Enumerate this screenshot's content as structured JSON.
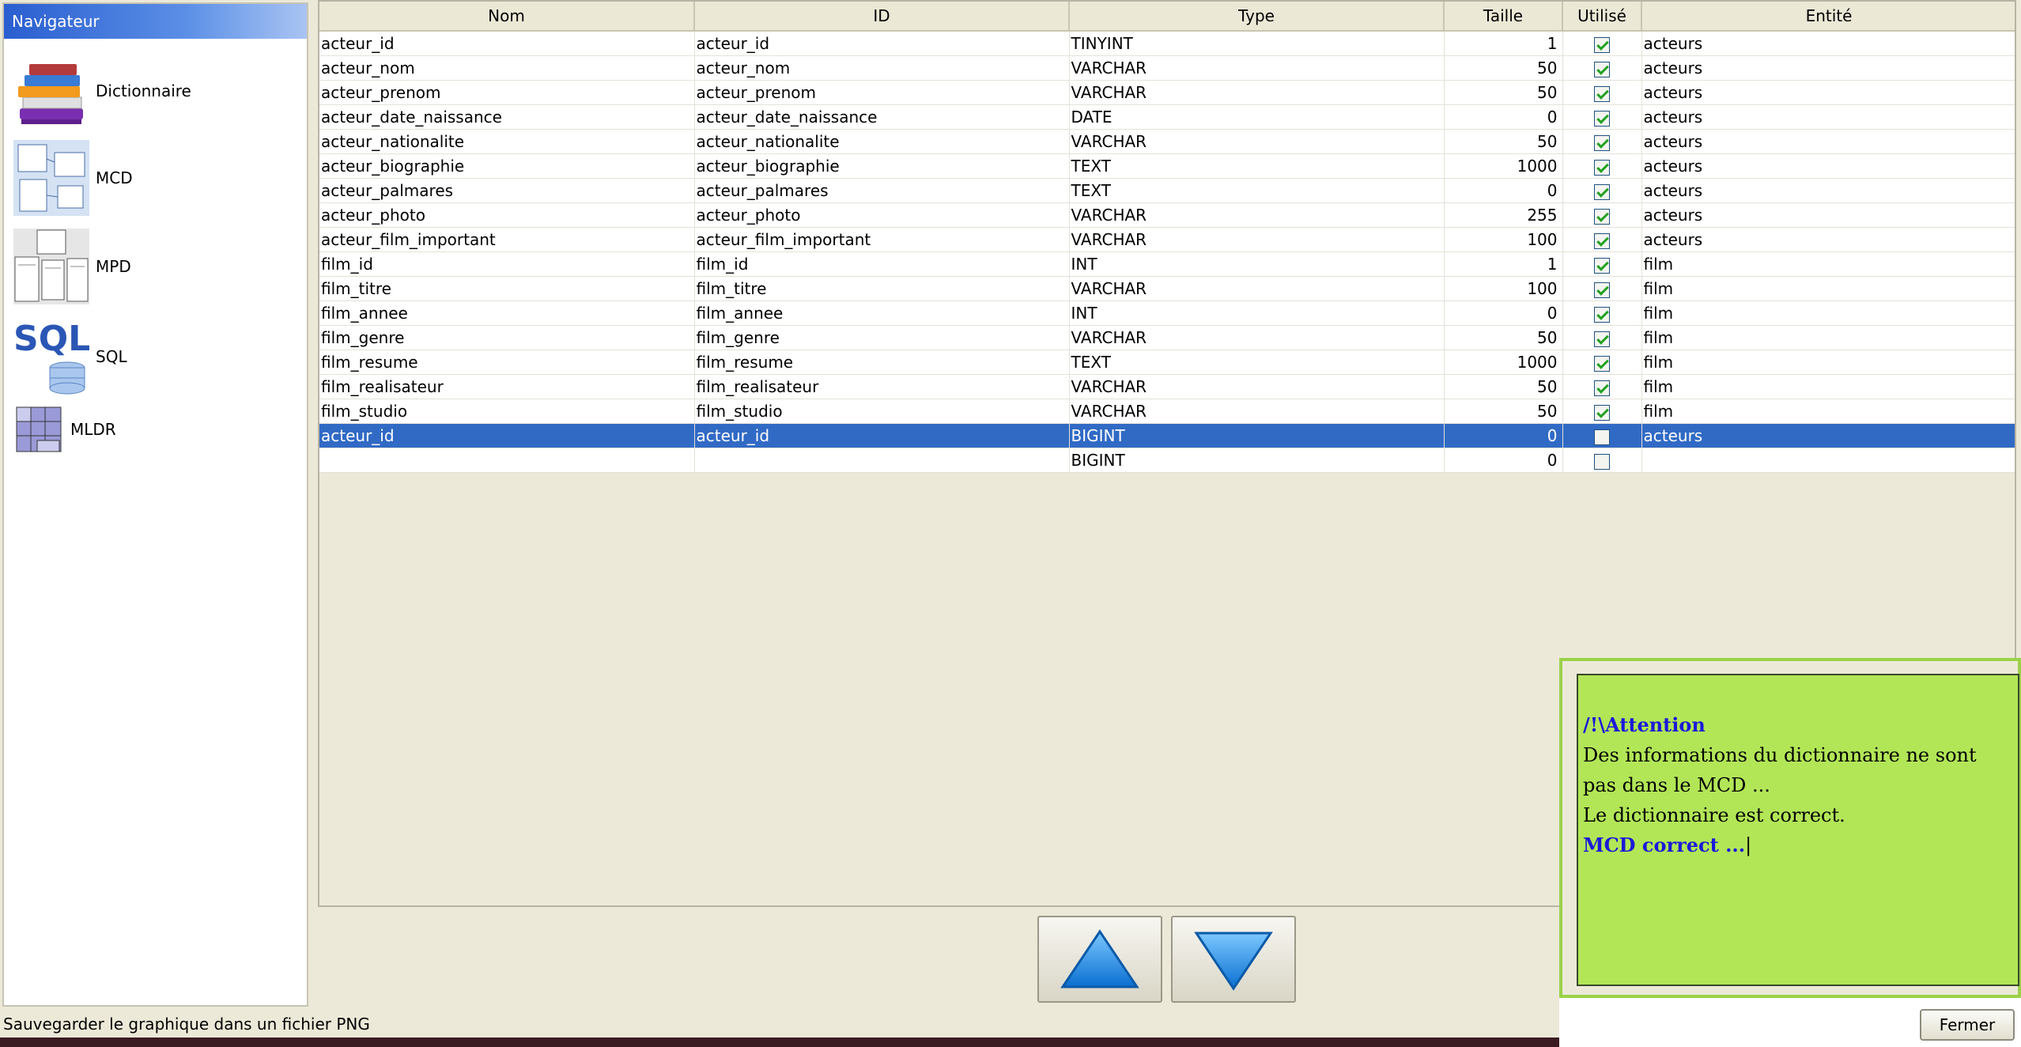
{
  "navigator": {
    "title": "Navigateur",
    "items": [
      {
        "label": "Dictionnaire",
        "icon": "books-icon"
      },
      {
        "label": "MCD",
        "icon": "mcd-diagram-icon"
      },
      {
        "label": "MPD",
        "icon": "mpd-diagram-icon"
      },
      {
        "label": "SQL",
        "icon": "sql-database-icon"
      },
      {
        "label": "MLDR",
        "icon": "mldr-grid-icon"
      }
    ],
    "sql_logo_text": "SQL"
  },
  "table": {
    "columns": [
      "Nom",
      "ID",
      "Type",
      "Taille",
      "Utilisé",
      "Entité"
    ],
    "rows": [
      {
        "nom": "acteur_id",
        "id": "acteur_id",
        "type": "TINYINT",
        "taille": "1",
        "used": true,
        "entite": "acteurs"
      },
      {
        "nom": "acteur_nom",
        "id": "acteur_nom",
        "type": "VARCHAR",
        "taille": "50",
        "used": true,
        "entite": "acteurs"
      },
      {
        "nom": "acteur_prenom",
        "id": "acteur_prenom",
        "type": "VARCHAR",
        "taille": "50",
        "used": true,
        "entite": "acteurs"
      },
      {
        "nom": "acteur_date_naissance",
        "id": "acteur_date_naissance",
        "type": "DATE",
        "taille": "0",
        "used": true,
        "entite": "acteurs"
      },
      {
        "nom": "acteur_nationalite",
        "id": "acteur_nationalite",
        "type": "VARCHAR",
        "taille": "50",
        "used": true,
        "entite": "acteurs"
      },
      {
        "nom": "acteur_biographie",
        "id": "acteur_biographie",
        "type": "TEXT",
        "taille": "1000",
        "used": true,
        "entite": "acteurs"
      },
      {
        "nom": "acteur_palmares",
        "id": "acteur_palmares",
        "type": "TEXT",
        "taille": "0",
        "used": true,
        "entite": "acteurs"
      },
      {
        "nom": "acteur_photo",
        "id": "acteur_photo",
        "type": "VARCHAR",
        "taille": "255",
        "used": true,
        "entite": "acteurs"
      },
      {
        "nom": "acteur_film_important",
        "id": "acteur_film_important",
        "type": "VARCHAR",
        "taille": "100",
        "used": true,
        "entite": "acteurs"
      },
      {
        "nom": "film_id",
        "id": "film_id",
        "type": "INT",
        "taille": "1",
        "used": true,
        "entite": "film"
      },
      {
        "nom": "film_titre",
        "id": "film_titre",
        "type": "VARCHAR",
        "taille": "100",
        "used": true,
        "entite": "film"
      },
      {
        "nom": "film_annee",
        "id": "film_annee",
        "type": "INT",
        "taille": "0",
        "used": true,
        "entite": "film"
      },
      {
        "nom": "film_genre",
        "id": "film_genre",
        "type": "VARCHAR",
        "taille": "50",
        "used": true,
        "entite": "film"
      },
      {
        "nom": "film_resume",
        "id": "film_resume",
        "type": "TEXT",
        "taille": "1000",
        "used": true,
        "entite": "film"
      },
      {
        "nom": "film_realisateur",
        "id": "film_realisateur",
        "type": "VARCHAR",
        "taille": "50",
        "used": true,
        "entite": "film"
      },
      {
        "nom": "film_studio",
        "id": "film_studio",
        "type": "VARCHAR",
        "taille": "50",
        "used": true,
        "entite": "film"
      },
      {
        "nom": "acteur_id",
        "id": "acteur_id",
        "type": "BIGINT",
        "taille": "0",
        "used": false,
        "entite": "acteurs",
        "selected": true
      },
      {
        "nom": "",
        "id": "",
        "type": "BIGINT",
        "taille": "0",
        "used": false,
        "entite": ""
      }
    ]
  },
  "message": {
    "title": "/!\\Attention",
    "line1": "Des informations du dictionnaire ne sont pas dans le MCD ...",
    "line2": "Le dictionnaire est correct.",
    "line3": "MCD correct ..."
  },
  "buttons": {
    "up_icon": "arrow-up-icon",
    "down_icon": "arrow-down-icon",
    "close_label": "Fermer"
  },
  "status_text": "Sauvegarder le graphique dans un fichier PNG",
  "colors": {
    "selection": "#316ac5",
    "message_bg": "#b2e657",
    "message_accent": "#1a1ad8",
    "arrow_blue": "#1e90e8"
  }
}
